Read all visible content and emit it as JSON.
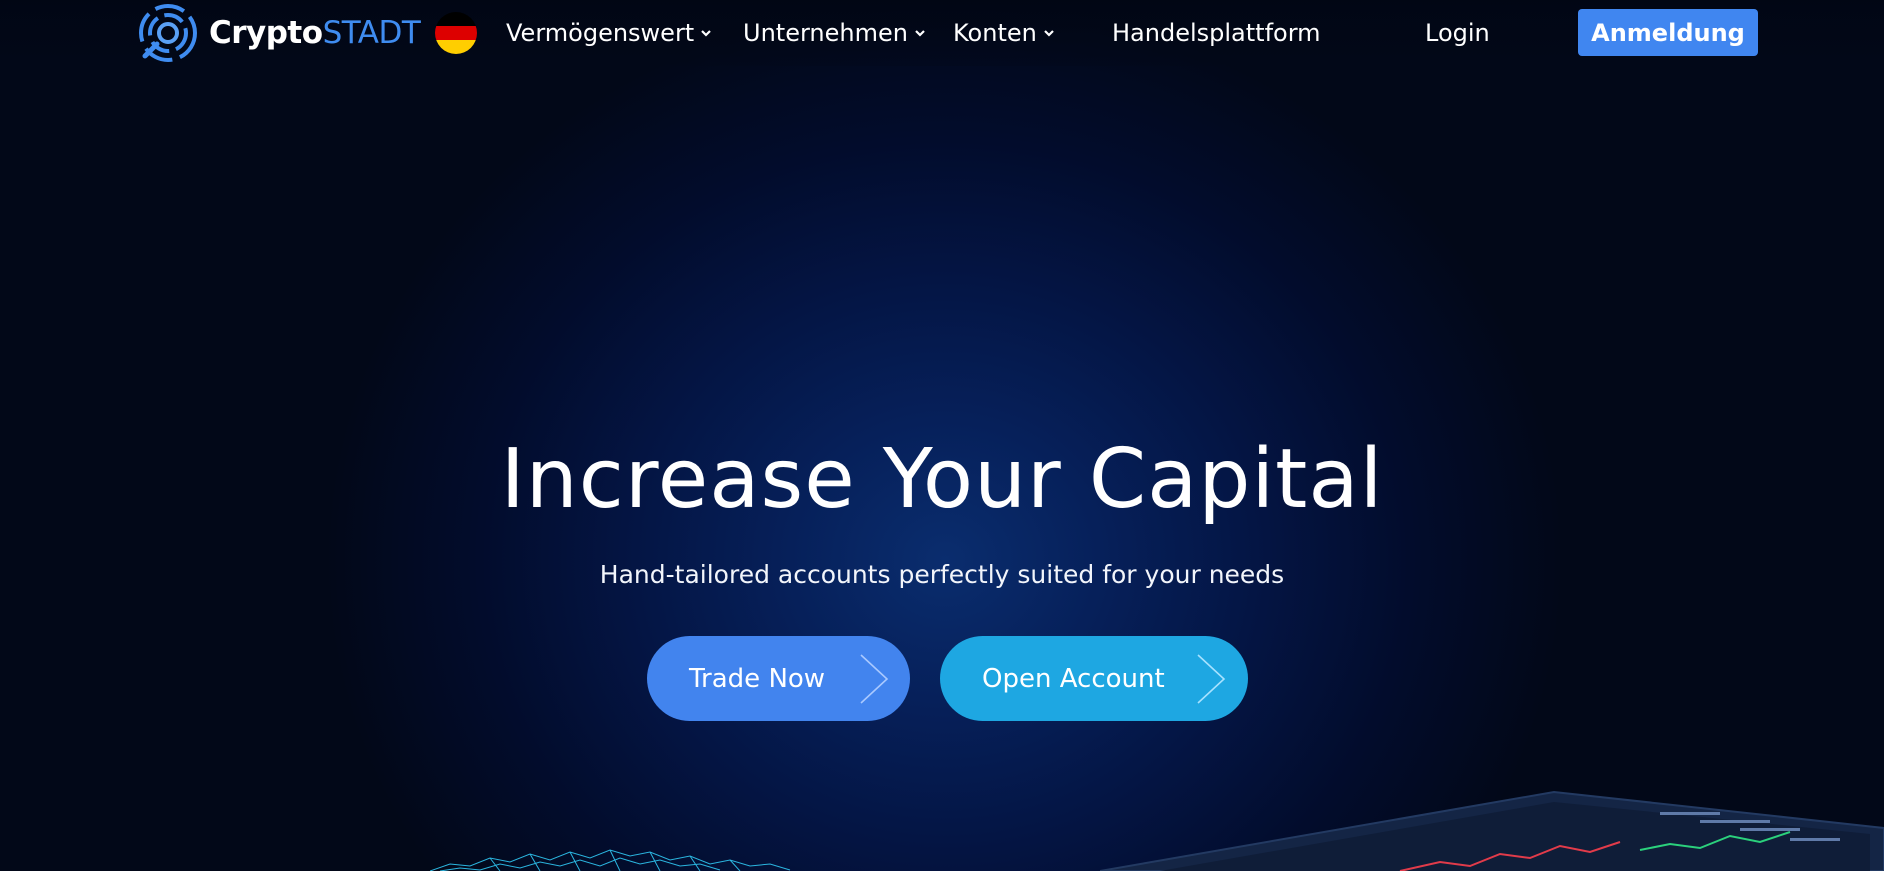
{
  "brand": {
    "name_bold": "Crypto",
    "name_light": "STADT",
    "accent_color": "#3f8cf0"
  },
  "language": {
    "flag": "germany-flag"
  },
  "nav": {
    "items": [
      {
        "label": "Vermögenswert",
        "has_dropdown": true
      },
      {
        "label": "Unternehmen",
        "has_dropdown": true
      },
      {
        "label": "Konten",
        "has_dropdown": true
      },
      {
        "label": "Handelsplattform",
        "has_dropdown": false
      }
    ],
    "login_label": "Login",
    "signup_label": "Anmeldung"
  },
  "hero": {
    "title": "Increase Your Capital",
    "subtitle": "Hand-tailored accounts perfectly suited for your needs",
    "buttons": [
      {
        "label": "Trade Now",
        "color": "#4284ee",
        "icon": "chevron-right-icon"
      },
      {
        "label": "Open Account",
        "color": "#1ea7e2",
        "icon": "chevron-right-icon"
      }
    ]
  }
}
